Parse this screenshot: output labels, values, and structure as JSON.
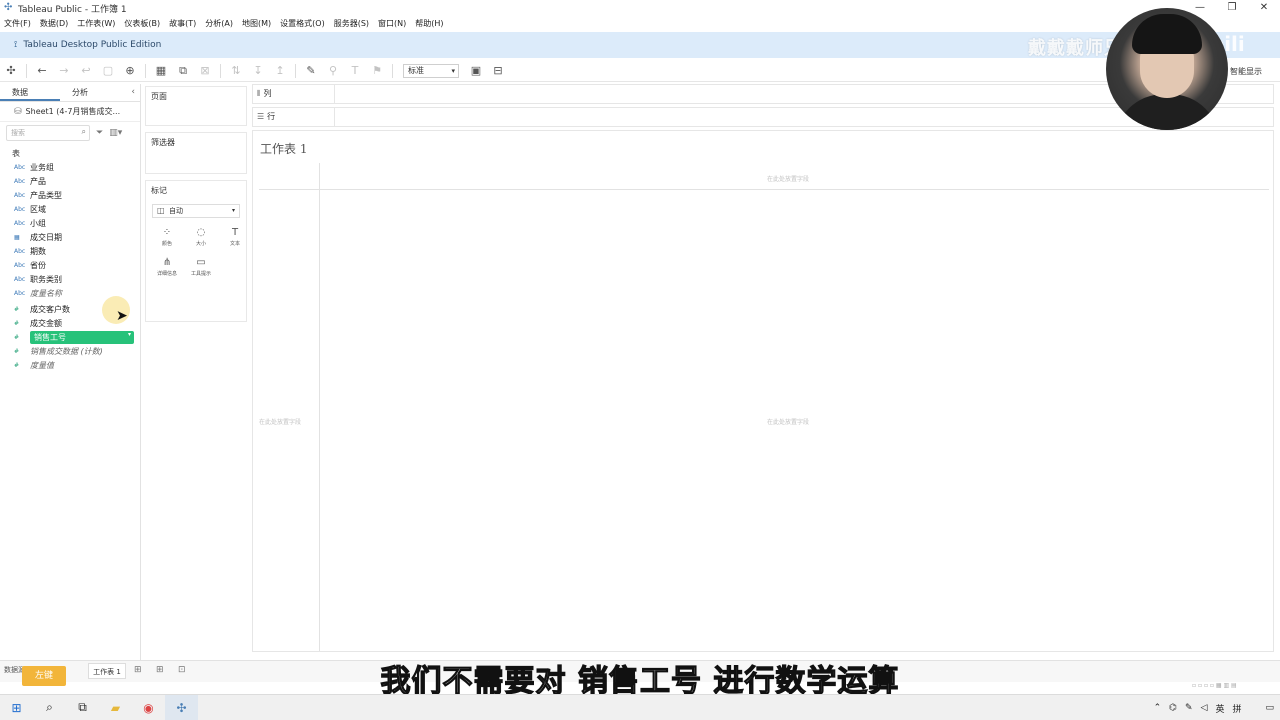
{
  "window": {
    "title": "Tableau Public - 工作簿 1",
    "controls": [
      "—",
      "❐",
      "✕"
    ]
  },
  "menu": [
    "文件(F)",
    "数据(D)",
    "工作表(W)",
    "仪表板(B)",
    "故事(T)",
    "分析(A)",
    "地图(M)",
    "设置格式(O)",
    "服务器(S)",
    "窗口(N)",
    "帮助(H)"
  ],
  "banner": {
    "edition": "Tableau Desktop Public Edition",
    "watermark": "戴戴戴师兄",
    "watermark_logo": "bilibili"
  },
  "toolbar": {
    "fit_select": "标准",
    "smart_show": "智能显示"
  },
  "data_pane": {
    "tab_data": "数据",
    "tab_analysis": "分析",
    "datasource": "Sheet1 (4-7月销售成交...",
    "search_placeholder": "搜索",
    "table_label": "表",
    "dimensions": [
      {
        "type": "Abc",
        "name": "业务组",
        "italic": false
      },
      {
        "type": "Abc",
        "name": "产品",
        "italic": false
      },
      {
        "type": "Abc",
        "name": "产品类型",
        "italic": false
      },
      {
        "type": "Abc",
        "name": "区域",
        "italic": false
      },
      {
        "type": "Abc",
        "name": "小组",
        "italic": false
      },
      {
        "type": "▦",
        "name": "成交日期",
        "italic": false
      },
      {
        "type": "Abc",
        "name": "期数",
        "italic": false
      },
      {
        "type": "Abc",
        "name": "省份",
        "italic": false
      },
      {
        "type": "Abc",
        "name": "职务类别",
        "italic": false
      },
      {
        "type": "Abc",
        "name": "度量名称",
        "italic": true
      }
    ],
    "measures": [
      {
        "type": "#",
        "name": "成交客户数",
        "italic": false
      },
      {
        "type": "#",
        "name": "成交金额",
        "italic": false
      },
      {
        "type": "#",
        "name": "销售工号",
        "italic": false,
        "selected": true
      },
      {
        "type": "#",
        "name": "销售成交数据 (计数)",
        "italic": true
      },
      {
        "type": "#",
        "name": "度量值",
        "italic": true
      }
    ]
  },
  "shelves": {
    "pages": "页面",
    "filters": "筛选器",
    "marks": "标记",
    "mark_type": "自动",
    "mark_buttons": [
      {
        "icon": "⁘",
        "label": "颜色"
      },
      {
        "icon": "◌",
        "label": "大小"
      },
      {
        "icon": "T",
        "label": "文本"
      },
      {
        "icon": "⋔",
        "label": "详细信息"
      },
      {
        "icon": "▭",
        "label": "工具提示"
      }
    ],
    "columns": "列",
    "rows": "行"
  },
  "canvas": {
    "sheet_title": "工作表 1",
    "drop_hint": "在此处放置字段"
  },
  "sheetbar": {
    "datasource_tab": "数据源",
    "sheet_tab": "工作表 1",
    "left_key": "左键"
  },
  "subtitle": "我们不需要对 销售工号 进行数学运算",
  "taskbar": {
    "lang": "英",
    "ime": "拼"
  }
}
